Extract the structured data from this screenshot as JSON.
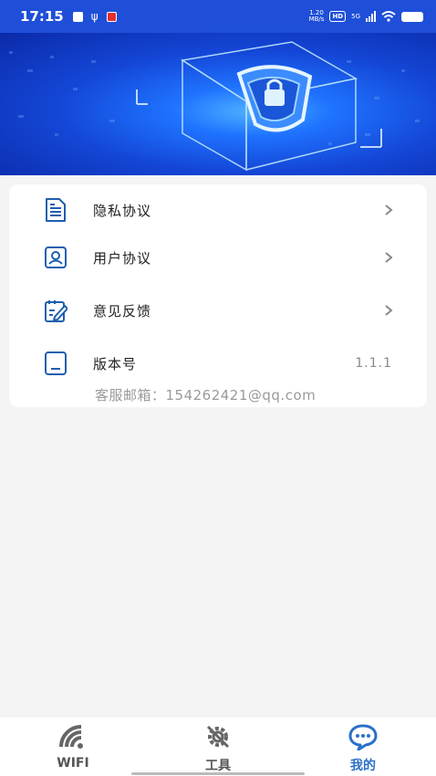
{
  "status_bar": {
    "time": "17:15",
    "speed_value": "1.20",
    "speed_unit": "MB/s",
    "hd": "HD",
    "network": "5G"
  },
  "menu": {
    "items": [
      {
        "label": "隐私协议",
        "icon": "document-icon"
      },
      {
        "label": "用户协议",
        "icon": "user-card-icon"
      },
      {
        "label": "意见反馈",
        "icon": "feedback-edit-icon"
      }
    ],
    "version": {
      "label": "版本号",
      "value": "1.1.1",
      "icon": "phone-icon"
    },
    "email_text": "客服邮箱：154262421@qq.com"
  },
  "bottom_nav": {
    "items": [
      {
        "label": "WIFI",
        "icon": "wifi-icon",
        "active": false
      },
      {
        "label": "工具",
        "icon": "tools-gear-icon",
        "active": false
      },
      {
        "label": "我的",
        "icon": "chat-bubble-icon",
        "active": true
      }
    ]
  },
  "colors": {
    "accent": "#2a6fc9",
    "inactive": "#666666",
    "icon_blue": "#1e5fae"
  }
}
